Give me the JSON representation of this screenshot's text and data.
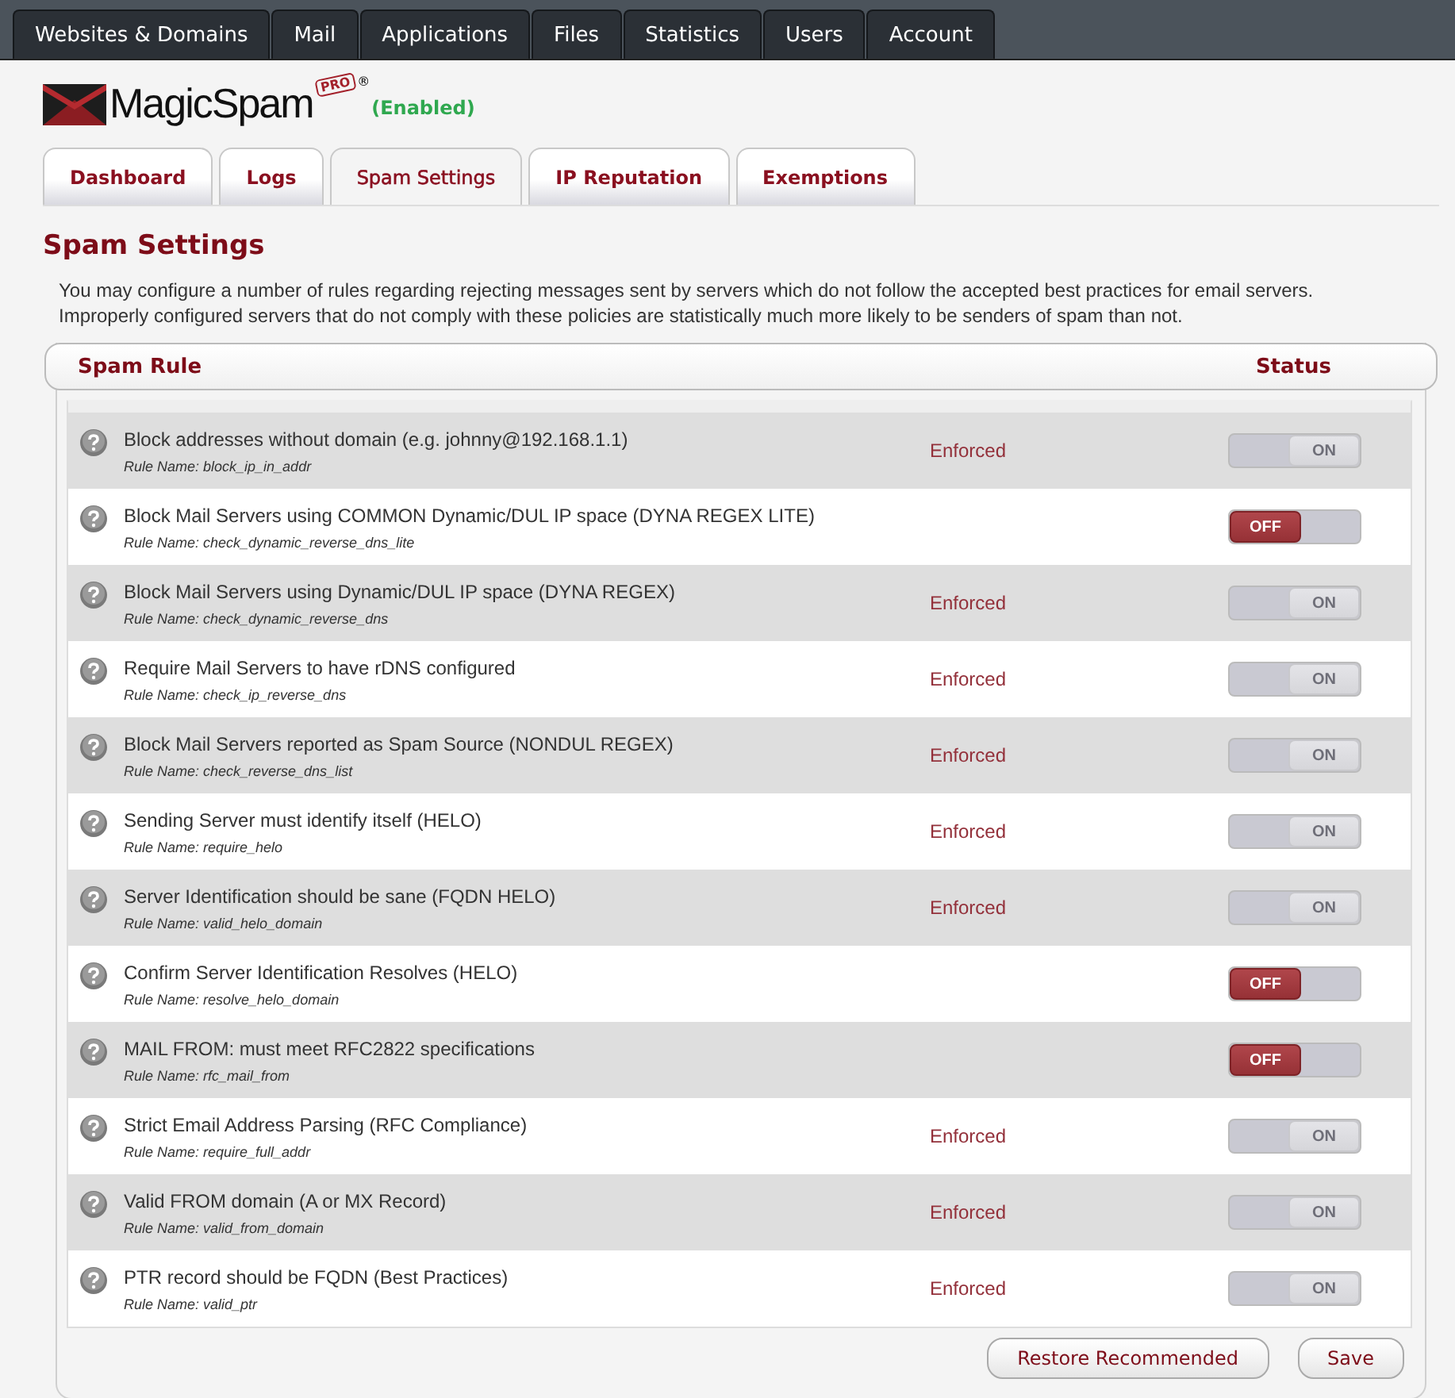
{
  "top_nav": [
    {
      "label": "Websites & Domains",
      "selected": false
    },
    {
      "label": "Mail",
      "selected": false
    },
    {
      "label": "Applications",
      "selected": false
    },
    {
      "label": "Files",
      "selected": false
    },
    {
      "label": "Statistics",
      "selected": false
    },
    {
      "label": "Users",
      "selected": false
    },
    {
      "label": "Account",
      "selected": false
    }
  ],
  "logo": {
    "name": "MagicSpam",
    "badge": "PRO",
    "registered": "®",
    "status": "(Enabled)"
  },
  "tabs": [
    {
      "label": "Dashboard",
      "selected": false
    },
    {
      "label": "Logs",
      "selected": false
    },
    {
      "label": "Spam Settings",
      "selected": true
    },
    {
      "label": "IP Reputation",
      "selected": false
    },
    {
      "label": "Exemptions",
      "selected": false
    }
  ],
  "heading": "Spam Settings",
  "description": "You may configure a number of rules regarding rejecting messages sent by servers which do not follow the accepted best practices for email servers. Improperly configured servers that do not comply with these policies are statistically much more likely to be senders of spam than not.",
  "table": {
    "columns": [
      "Spam Rule",
      "Status"
    ],
    "rows": [
      {
        "title": "Block addresses without domain (e.g. johnny@192.168.1.1)",
        "rule_name": "Rule Name: block_ip_in_addr",
        "status": "Enforced",
        "on": true,
        "toggle_label": "ON"
      },
      {
        "title": "Block Mail Servers using COMMON Dynamic/DUL IP space (DYNA REGEX LITE)",
        "rule_name": "Rule Name: check_dynamic_reverse_dns_lite",
        "on": false,
        "toggle_label": "OFF"
      },
      {
        "title": "Block Mail Servers using Dynamic/DUL IP space (DYNA REGEX)",
        "rule_name": "Rule Name: check_dynamic_reverse_dns",
        "status": "Enforced",
        "on": true,
        "toggle_label": "ON"
      },
      {
        "title": "Require Mail Servers to have rDNS configured",
        "rule_name": "Rule Name: check_ip_reverse_dns",
        "status": "Enforced",
        "on": true,
        "toggle_label": "ON"
      },
      {
        "title": "Block Mail Servers reported as Spam Source (NONDUL REGEX)",
        "rule_name": "Rule Name: check_reverse_dns_list",
        "status": "Enforced",
        "on": true,
        "toggle_label": "ON"
      },
      {
        "title": "Sending Server must identify itself (HELO)",
        "rule_name": "Rule Name: require_helo",
        "status": "Enforced",
        "on": true,
        "toggle_label": "ON"
      },
      {
        "title": "Server Identification should be sane (FQDN HELO)",
        "rule_name": "Rule Name: valid_helo_domain",
        "status": "Enforced",
        "on": true,
        "toggle_label": "ON"
      },
      {
        "title": "Confirm Server Identification Resolves (HELO)",
        "rule_name": "Rule Name: resolve_helo_domain",
        "on": false,
        "toggle_label": "OFF"
      },
      {
        "title": "MAIL FROM: must meet RFC2822 specifications",
        "rule_name": "Rule Name: rfc_mail_from",
        "on": false,
        "toggle_label": "OFF"
      },
      {
        "title": "Strict Email Address Parsing (RFC Compliance)",
        "rule_name": "Rule Name: require_full_addr",
        "status": "Enforced",
        "on": true,
        "toggle_label": "ON"
      },
      {
        "title": "Valid FROM domain (A or MX Record)",
        "rule_name": "Rule Name: valid_from_domain",
        "status": "Enforced",
        "on": true,
        "toggle_label": "ON"
      },
      {
        "title": "PTR record should be FQDN (Best Practices)",
        "rule_name": "Rule Name: valid_ptr",
        "status": "Enforced",
        "on": true,
        "toggle_label": "ON"
      }
    ]
  },
  "buttons": [
    "Restore Recommended",
    "Save"
  ]
}
